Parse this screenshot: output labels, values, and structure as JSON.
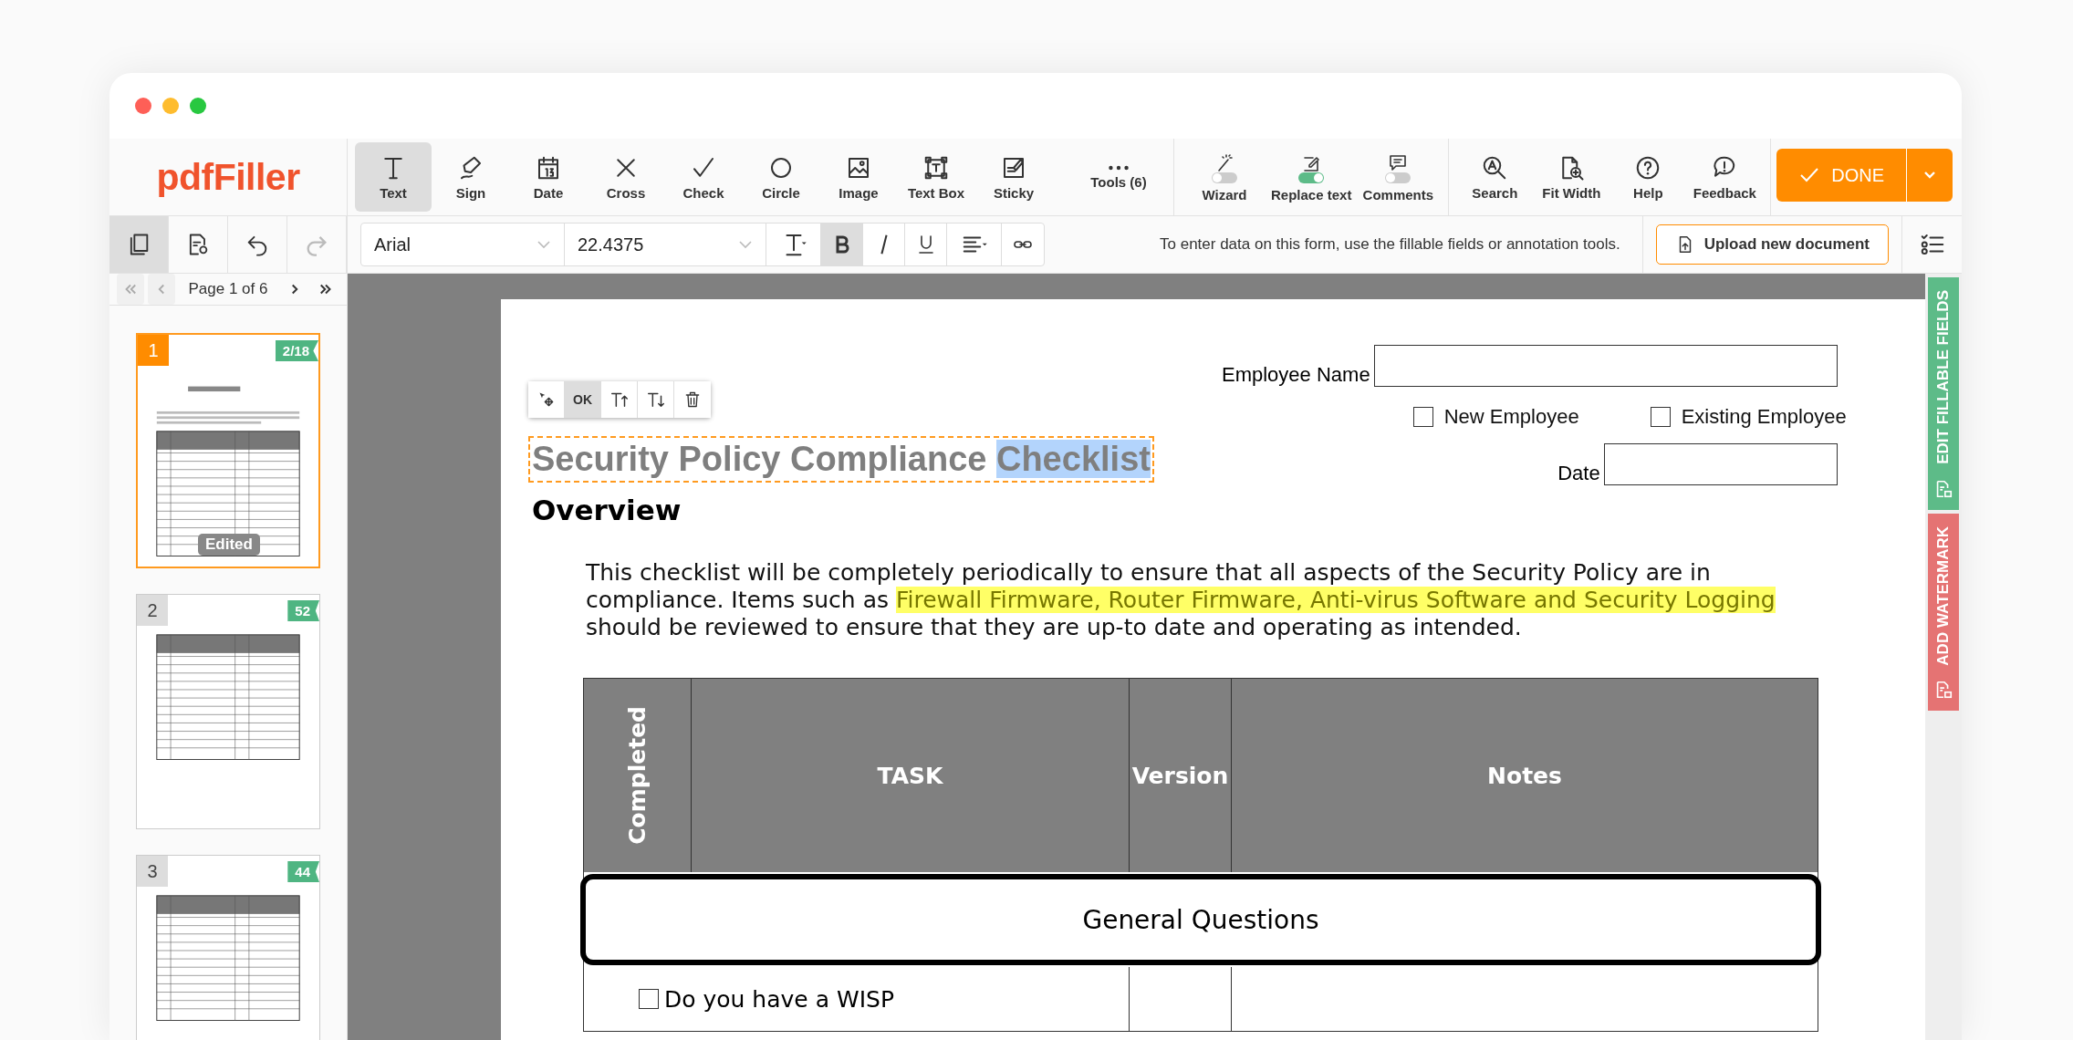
{
  "logo": "pdfFiller",
  "tools": [
    {
      "label": "Text",
      "selected": true
    },
    {
      "label": "Sign",
      "selected": false
    },
    {
      "label": "Date",
      "selected": false
    },
    {
      "label": "Cross",
      "selected": false
    },
    {
      "label": "Check",
      "selected": false
    },
    {
      "label": "Circle",
      "selected": false
    },
    {
      "label": "Image",
      "selected": false
    },
    {
      "label": "Text Box",
      "selected": false
    },
    {
      "label": "Sticky",
      "selected": false
    },
    {
      "label": "Tools (6)",
      "selected": false
    }
  ],
  "toggles": [
    {
      "label": "Wizard",
      "on": false
    },
    {
      "label": "Replace text",
      "on": true
    },
    {
      "label": "Comments",
      "on": false
    }
  ],
  "nav_tools": [
    "Search",
    "Fit Width",
    "Help",
    "Feedback"
  ],
  "done_button": "DONE",
  "format_bar": {
    "font": "Arial",
    "size": "22.4375",
    "bold": true,
    "italic": false,
    "underline": false
  },
  "hint": "To enter data on this form, use the fillable fields or annotation tools.",
  "upload_button": "Upload new document",
  "sidebar": {
    "page_label": "Page 1 of 6",
    "pages": [
      {
        "number": "1",
        "badge": "2/18",
        "selected": true,
        "status": "Edited"
      },
      {
        "number": "2",
        "badge": "52",
        "selected": false
      },
      {
        "number": "3",
        "badge": "44",
        "selected": false
      }
    ]
  },
  "side_tabs": [
    {
      "label": "EDIT FILLABLE FIELDS",
      "color": "#5dbb88"
    },
    {
      "label": "ADD WATERMARK",
      "color": "#e57373"
    }
  ],
  "document": {
    "text_toolbar": {
      "ok": "OK"
    },
    "title_parts": [
      {
        "text": "Security Policy Compliance ",
        "selected": false
      },
      {
        "text": "Checklist",
        "selected": true
      }
    ],
    "employee_name_label": "Employee Name",
    "checkboxes": [
      {
        "label": "New Employee",
        "checked": false
      },
      {
        "label": "Existing Employee",
        "checked": false
      }
    ],
    "date_label": "Date",
    "heading": "Overview",
    "paragraph_parts": [
      {
        "text": "This checklist will be completely periodically to ensure that all aspects of the Security Policy are in compliance.  Items such as ",
        "highlighted": false
      },
      {
        "text": "Firewall Firmware, Router Firmware, Anti-virus Software and Security Logging",
        "highlighted": true
      },
      {
        "text": " should be reviewed to ensure that they are up-to date and operating as intended.",
        "highlighted": false
      }
    ],
    "table": {
      "columns": [
        "Completed",
        "TASK",
        "Version",
        "Notes"
      ],
      "section": "General Questions",
      "rows": [
        {
          "task": "Do you have a WISP",
          "checked": false
        }
      ]
    }
  }
}
